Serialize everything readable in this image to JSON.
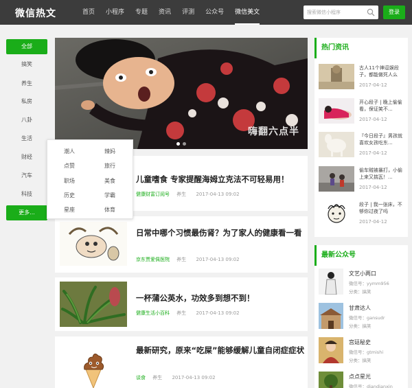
{
  "header": {
    "logo": "微信热文",
    "nav": [
      "首页",
      "小程序",
      "专题",
      "资讯",
      "评测",
      "公众号",
      "微信美文"
    ],
    "search_placeholder": "搜索微信小程序",
    "login_label": "登录"
  },
  "categories": [
    "全部",
    "搞笑",
    "养生",
    "私房",
    "八卦",
    "生活",
    "财经",
    "汽车",
    "科技",
    "更多..."
  ],
  "dropdown": [
    "潮人",
    "辣妈",
    "点赞",
    "旅行",
    "职场",
    "美食",
    "历史",
    "学霸",
    "星座",
    "体育"
  ],
  "banner": {
    "caption": "嗨翻六点半"
  },
  "articles": [
    {
      "title": "儿童嗜食 专家提醒海姆立克法不可轻易用！",
      "source": "健康财富订阅号",
      "tag": "养生",
      "time": "2017-04-13 09:02",
      "icon": "child-thumbnail"
    },
    {
      "title": "日常中哪个习惯最伤肾？为了家人的健康看一看",
      "source": "京东贾爱佩医院",
      "tag": "养生",
      "time": "2017-04-13 09:02",
      "icon": "kidney-cartoon-thumbnail"
    },
    {
      "title": "一杯蒲公英水，功效多到想不到！",
      "source": "健康生活小百科",
      "tag": "养生",
      "time": "2017-04-13 09:02",
      "icon": "dandelion-thumbnail"
    },
    {
      "title": "最新研究，原来“吃屎”能够缓解儿童自闭症症状",
      "source": "谈食",
      "tag": "养生",
      "time": "2017-04-13 09:02",
      "icon": "poop-icecream-thumbnail"
    }
  ],
  "hot_news": {
    "title": "热门资讯",
    "items": [
      {
        "text": "古人11个神逗娱段子，都能做死人么",
        "date": "2017-04-12",
        "icon": "statue-thumbnail"
      },
      {
        "text": "开心段子 | 晚上偷偷看，保证笑不...",
        "date": "2017-04-12",
        "icon": "woman-bed-thumbnail"
      },
      {
        "text": "『今日段子』男孩就喜欢女孩吃东...",
        "date": "2017-04-12",
        "icon": "horse-thumbnail"
      },
      {
        "text": "偷车贼被暴打，小偷上来又揣瓦！...",
        "date": "2017-04-12",
        "icon": "street-thumbnail"
      },
      {
        "text": "段子 | 我一张床，不够你过夜了吗",
        "date": "2017-04-12",
        "icon": "cartoon-face-thumbnail"
      }
    ]
  },
  "accounts": {
    "title": "最新公众号",
    "items": [
      {
        "name": "文艺小两口",
        "wechat": "微信号：yymm956",
        "category": "分类：搞笑",
        "icon": "couple-thumbnail"
      },
      {
        "name": "甘肃达人",
        "wechat": "微信号：gansudr",
        "category": "分类：搞笑",
        "icon": "building-thumbnail"
      },
      {
        "name": "宫廷秘史",
        "wechat": "微信号：gtmishi",
        "category": "分类：搞笑",
        "icon": "palace-thumbnail"
      },
      {
        "name": "点点星光",
        "wechat": "微信号：diandianxin",
        "category": "分类：搞笑",
        "icon": "tree-thumbnail"
      }
    ]
  },
  "colors": {
    "brand": "#1aad19",
    "topbar": "#3c3c3c",
    "background": "#f1f1f1"
  }
}
